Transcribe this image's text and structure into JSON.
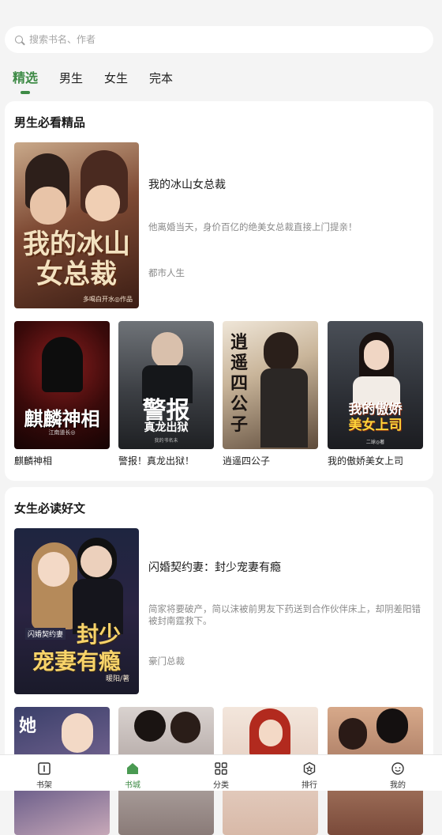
{
  "search": {
    "placeholder": "搜索书名、作者"
  },
  "tabs": [
    {
      "label": "精选",
      "active": true
    },
    {
      "label": "男生",
      "active": false
    },
    {
      "label": "女生",
      "active": false
    },
    {
      "label": "完本",
      "active": false
    }
  ],
  "section_male": {
    "title": "男生必看精品",
    "featured": {
      "title": "我的冰山女总裁",
      "desc": "他离婚当天，身价百亿的绝美女总裁直接上门提亲！",
      "tag": "都市人生",
      "cover_text": "我的冰山女总裁",
      "cover_author": "多喝白开水◎作品"
    },
    "books": [
      {
        "name": "麒麟神相",
        "cover_text": "麒麟神相",
        "cover_author": "江南道长◎"
      },
      {
        "name": "警报！真龙出狱！",
        "cover_text": "警报",
        "cover_sub": "真龙出狱",
        "cover_author": "我的书名未"
      },
      {
        "name": "逍遥四公子",
        "cover_text": "逍遥四公子",
        "cover_author": ""
      },
      {
        "name": "我的傲娇美女上司",
        "cover_text": "我的傲娇美女上司",
        "cover_author": "二球◎著"
      }
    ]
  },
  "section_female": {
    "title": "女生必读好文",
    "featured": {
      "title": "闪婚契约妻：封少宠妻有瘾",
      "desc": "简家将要破产，简以沫被前男友下药送到合作伙伴床上，却阴差阳错被封南霆救下。",
      "tag": "豪门总裁",
      "cover_text": "封少宠妻有瘾",
      "cover_sub": "闪婚契约妻",
      "cover_author": "暖阳/著"
    }
  },
  "nav": [
    {
      "label": "书架",
      "icon": "book-icon"
    },
    {
      "label": "书城",
      "icon": "store-icon",
      "active": true
    },
    {
      "label": "分类",
      "icon": "grid-icon"
    },
    {
      "label": "排行",
      "icon": "rank-icon"
    },
    {
      "label": "我的",
      "icon": "profile-icon"
    }
  ],
  "colors": {
    "accent": "#3d8a45",
    "background": "#f4f4f4"
  }
}
